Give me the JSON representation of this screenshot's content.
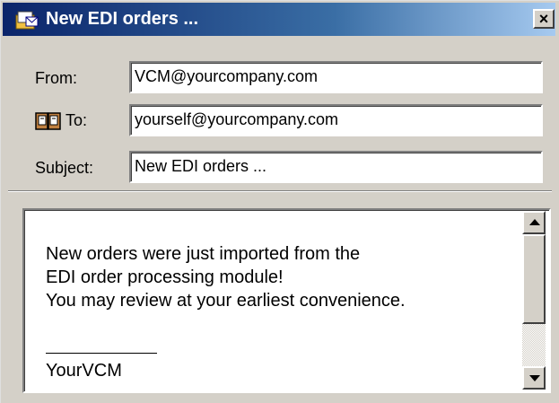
{
  "window": {
    "title": "New EDI orders ...",
    "close_glyph": "×",
    "app_icon": "envelope-folder-icon"
  },
  "fields": {
    "from": {
      "label": "From:",
      "value": "VCM@yourcompany.com"
    },
    "to": {
      "label": "To:",
      "value": "yourself@yourcompany.com",
      "icon": "address-book-icon"
    },
    "subject": {
      "label": "Subject:",
      "value": "New EDI orders ..."
    }
  },
  "message": {
    "lines": [
      "New orders were just imported from the",
      "EDI order processing module!",
      "You may review at your earliest convenience."
    ],
    "signature": "YourVCM"
  },
  "colors": {
    "titlebar_start": "#0a246a",
    "titlebar_end": "#a6caf0",
    "face": "#d4d0c8"
  }
}
